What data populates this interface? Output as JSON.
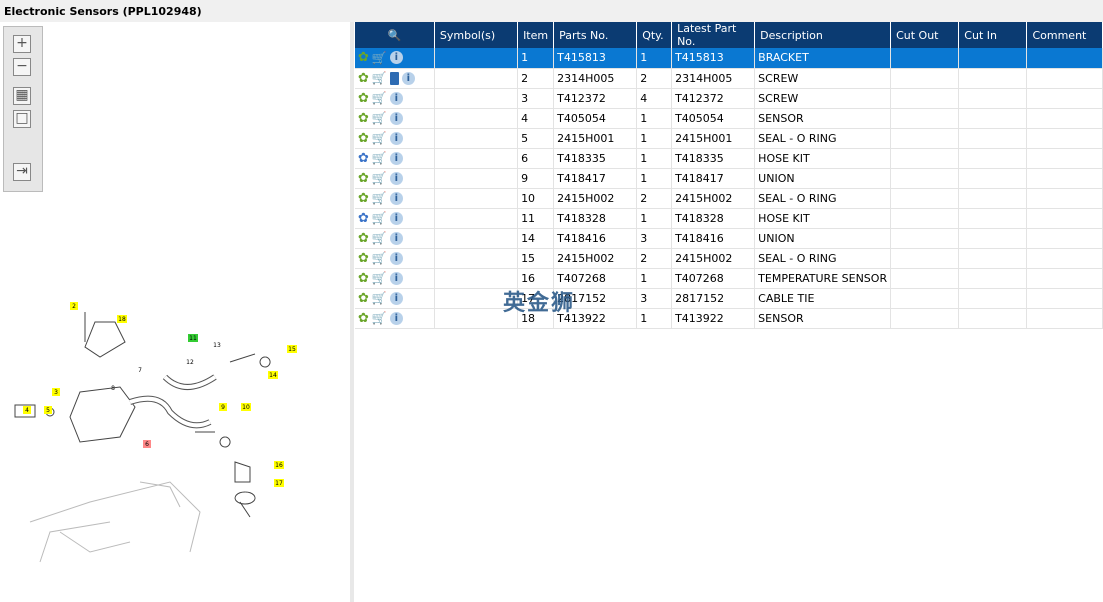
{
  "title": "Electronic Sensors (PPL102948)",
  "toolbar": {
    "zoom_in": "+",
    "zoom_out": "−",
    "fit": "▦",
    "actual": "□",
    "export": "⇥"
  },
  "columns": [
    "",
    "Symbol(s)",
    "Item",
    "Parts No.",
    "Qty.",
    "Latest Part No.",
    "Description",
    "Cut Out",
    "Cut In",
    "Comment"
  ],
  "rows": [
    {
      "item": "1",
      "part": "T415813",
      "qty": "1",
      "latest": "T415813",
      "desc": "BRACKET",
      "gear": "green",
      "book": false
    },
    {
      "item": "2",
      "part": "2314H005",
      "qty": "2",
      "latest": "2314H005",
      "desc": "SCREW",
      "gear": "green",
      "book": true
    },
    {
      "item": "3",
      "part": "T412372",
      "qty": "4",
      "latest": "T412372",
      "desc": "SCREW",
      "gear": "green",
      "book": false
    },
    {
      "item": "4",
      "part": "T405054",
      "qty": "1",
      "latest": "T405054",
      "desc": "SENSOR",
      "gear": "green",
      "book": false
    },
    {
      "item": "5",
      "part": "2415H001",
      "qty": "1",
      "latest": "2415H001",
      "desc": "SEAL - O RING",
      "gear": "green",
      "book": false
    },
    {
      "item": "6",
      "part": "T418335",
      "qty": "1",
      "latest": "T418335",
      "desc": "HOSE KIT",
      "gear": "blue",
      "book": false
    },
    {
      "item": "9",
      "part": "T418417",
      "qty": "1",
      "latest": "T418417",
      "desc": "UNION",
      "gear": "green",
      "book": false
    },
    {
      "item": "10",
      "part": "2415H002",
      "qty": "2",
      "latest": "2415H002",
      "desc": "SEAL - O RING",
      "gear": "green",
      "book": false
    },
    {
      "item": "11",
      "part": "T418328",
      "qty": "1",
      "latest": "T418328",
      "desc": "HOSE KIT",
      "gear": "blue",
      "book": false
    },
    {
      "item": "14",
      "part": "T418416",
      "qty": "3",
      "latest": "T418416",
      "desc": "UNION",
      "gear": "green",
      "book": false
    },
    {
      "item": "15",
      "part": "2415H002",
      "qty": "2",
      "latest": "2415H002",
      "desc": "SEAL - O RING",
      "gear": "green",
      "book": false
    },
    {
      "item": "16",
      "part": "T407268",
      "qty": "1",
      "latest": "T407268",
      "desc": "TEMPERATURE SENSOR",
      "gear": "green",
      "book": false
    },
    {
      "item": "17",
      "part": "2817152",
      "qty": "3",
      "latest": "2817152",
      "desc": "CABLE TIE",
      "gear": "green",
      "book": false
    },
    {
      "item": "18",
      "part": "T413922",
      "qty": "1",
      "latest": "T413922",
      "desc": "SENSOR",
      "gear": "green",
      "book": false
    }
  ],
  "watermark": "英金狮",
  "callouts": [
    "2",
    "18",
    "11",
    "13",
    "12",
    "15",
    "14",
    "7",
    "8",
    "3",
    "4",
    "5",
    "9",
    "10",
    "6",
    "16",
    "17"
  ]
}
